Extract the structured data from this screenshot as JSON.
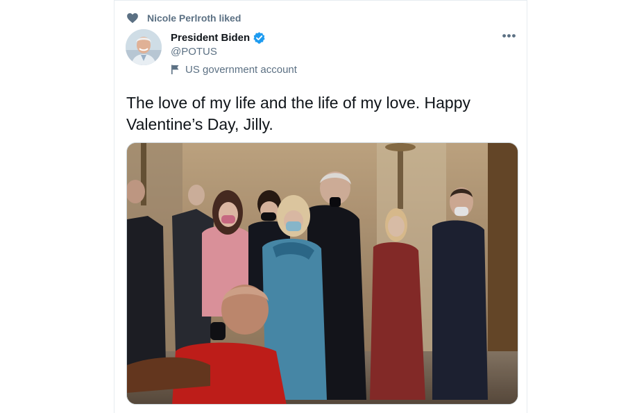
{
  "social_context": {
    "icon": "heart-icon",
    "text": "Nicole Perlroth liked"
  },
  "author": {
    "name": "President Biden",
    "handle": "@POTUS",
    "verified_icon": "verified-badge-icon",
    "account_label_icon": "flag-icon",
    "account_label": "US government account"
  },
  "more_label": "•••",
  "tweet": {
    "text": "The love of my life and the life of my love. Happy Valentine’s Day, Jilly."
  },
  "media": {
    "description_icon": "photo"
  },
  "colors": {
    "secondary_text": "#5b7083",
    "verified_blue": "#1d9bf0",
    "border": "#e6ecf0"
  }
}
